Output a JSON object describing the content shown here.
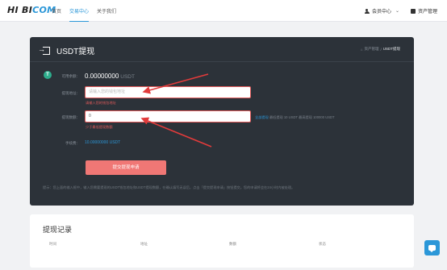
{
  "header": {
    "logo_main": "HI BI",
    "logo_accent": "COM",
    "nav": [
      "首页",
      "交易中心",
      "关于我们"
    ],
    "user_menu_label": "会员中心",
    "asset_link_label": "资产管理"
  },
  "withdraw": {
    "title": "USDT提现",
    "breadcrumb": [
      "资产管理",
      "USDT提现"
    ],
    "balance_label": "可用余额：",
    "balance_value": "0.00000000",
    "balance_unit": "USDT",
    "address_label": "提现地址：",
    "address_placeholder": "请输入您的钱包地址",
    "address_error": "请输入您的钱包地址",
    "amount_label": "提现数额：",
    "amount_value": "0",
    "amount_error": "少于最低提现数额",
    "amount_hint_link": "全部提现",
    "amount_hint_text": "最低提现 10 USDT 最高提现 100000 USDT",
    "fee_label": "手续费：",
    "fee_value": "10.00000000 USDT",
    "submit_label": "提交提现申请",
    "tip": "提示：您上面的输入框中，输入您需要提现的USDT钱包地址和USDT提现数额，在确认填写无误后，点击「提交提现申请」按钮提交。您的申请将会在24小时内被处理。"
  },
  "records": {
    "title": "提现记录",
    "columns": [
      "时间",
      "地址",
      "数额",
      "状态"
    ]
  },
  "colors": {
    "accent": "#2b97d8",
    "error": "#e05a5a",
    "submit": "#f07775",
    "card_bg": "#2c3239",
    "usdt": "#2dad8c"
  },
  "icons": [
    "user-icon",
    "asset-icon",
    "chevron-down-icon",
    "exit-icon",
    "usdt-icon",
    "chat-icon"
  ]
}
